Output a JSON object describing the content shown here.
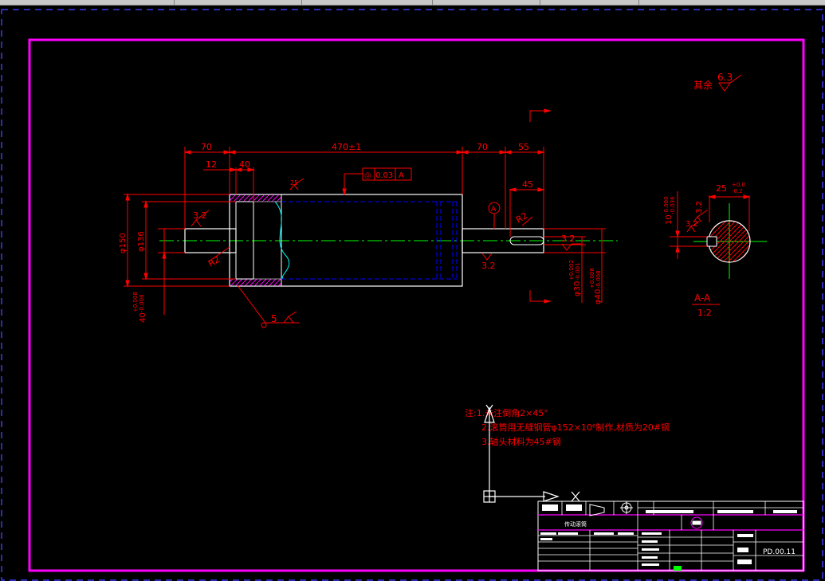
{
  "colors": {
    "background": "#000000",
    "border": "#ff00ff",
    "dim": "#ff0000",
    "outline": "#ffffff",
    "center": "#00ff00",
    "hidden": "#0000ff",
    "hatch": "#ff00ff",
    "curve": "#00ffff"
  },
  "dimensions": {
    "d70_left": "70",
    "d470": "470±1",
    "d70_right": "70",
    "d55": "55",
    "d12": "12",
    "d40": "40",
    "d45": "45",
    "d150": "φ150",
    "d136": "φ136",
    "d40tol": "40",
    "d40tol_upper": "+0.008",
    "d40tol_lower": "-0.008",
    "d30": "φ30",
    "d30_upper": "+0.002",
    "d30_lower": "-0.001",
    "d40r": "φ40",
    "d40r_upper": "+0.008",
    "d40r_lower": "-0.008",
    "r2_left": "R2",
    "r2_right": "R2",
    "rough32_a": "3.2",
    "rough32_b": "3.2",
    "rough32_c": "3.2",
    "rough25": "25",
    "rough5": "5",
    "tolerance_symbol": "◎",
    "tolerance_value": "0.03",
    "tolerance_datum": "A",
    "datum_marker": "A"
  },
  "section": {
    "d25": "25",
    "d25_upper": "+0.0",
    "d25_lower": "-0.2",
    "d10": "10",
    "d10_upper": "-0.000",
    "d10_lower": "-0.036",
    "rough32_a": "3.2",
    "rough32_b": "3.2",
    "label": "A-A",
    "scale": "1:2"
  },
  "roughness_note": {
    "text": "其余",
    "value": "6.3"
  },
  "notes": {
    "line1": "注:1.未注倒角2×45°",
    "line2": "2.滚筒用无缝钢管φ152×10⁶制作,材质为20#钢",
    "line3": "3.轴头材料为45#钢"
  },
  "title_block": {
    "part_name": "传动滚筒",
    "drawing_number": "PD.00.11"
  }
}
